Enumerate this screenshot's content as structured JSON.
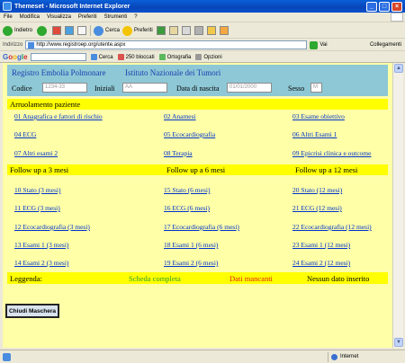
{
  "window": {
    "title": "Themeset - Microsoft Internet Explorer",
    "buttons": [
      "_",
      "□",
      "×"
    ]
  },
  "menu": [
    "File",
    "Modifica",
    "Visualizza",
    "Preferiti",
    "Strumenti",
    "?"
  ],
  "toolbar": {
    "back": "Indietro",
    "search": "Cerca",
    "favorites": "Preferiti"
  },
  "address": {
    "label": "Indirizzo",
    "url": "http://www.registroep.org/utente.aspx",
    "go": "Vai",
    "links": "Collegamenti"
  },
  "googlebar": {
    "logo": [
      "G",
      "o",
      "o",
      "g",
      "l",
      "e"
    ],
    "search": "Cerca",
    "blocked": "250 bloccati",
    "spell": "Ortografia",
    "options": "Opzioni"
  },
  "header": {
    "title_left": "Registro Embolia Polmonare",
    "title_right": "Istituto Nazionale dei Tumori",
    "codice_label": "Codice",
    "codice_placeholder": "1234-33",
    "iniziali_label": "Iniziali",
    "iniziali_placeholder": "AA",
    "nascita_label": "Data di nascita",
    "nascita_placeholder": "01/01/2000",
    "sesso_label": "Sesso",
    "sesso_placeholder": "M"
  },
  "arruolamento": {
    "title": "Arruolamento paziente",
    "links": [
      "01 Anagrafica e fattori di rischio",
      "02 Anamesi",
      "03 Esame obiettivo",
      "04 ECG",
      "05 Ecocardiografia",
      "06 Altri Esami 1",
      "07 Altri esami 2",
      "08 Terapia",
      "09 Epicrisi clinica e outcome"
    ]
  },
  "followup": {
    "titles": [
      "Follow up a 3 mesi",
      "Follow up a 6 mesi",
      "Follow up a 12 mesi"
    ],
    "links": [
      "10 Stato (3 mesi)",
      "15 Stato (6 mesi)",
      "20 Stato (12 mesi)",
      "11 ECG (3 mesi)",
      "16 ECG (6 mesi)",
      "21 ECG (12 mesi)",
      "12 Ecocardiografia (3 mesi)",
      "17 Ecocardiografia (6 mesi)",
      "22 Ecocardiografia (12 mesi)",
      "13 Esami 1 (3 mesi)",
      "18 Esami 1 (6 mesi)",
      "23 Esami 1 (12 mesi)",
      "14 Esami 2 (3 mesi)",
      "19 Esami 2 (6 mesi)",
      "24 Esami 2 (12 mesi)"
    ]
  },
  "legend": {
    "label": "Leggenda:",
    "complete": "Scheda completa",
    "complete_color": "#2e9e2e",
    "missing": "Dati mancanti",
    "missing_color": "#e0201a",
    "none": "Nessun dato inserito"
  },
  "close_button": "Chiudi Maschera",
  "status": {
    "zone": "Internet"
  }
}
